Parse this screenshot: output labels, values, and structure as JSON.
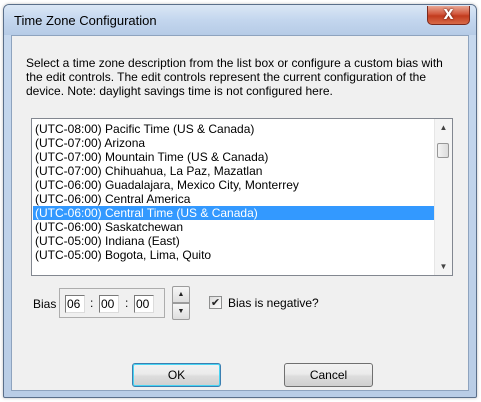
{
  "window": {
    "title": "Time Zone Configuration",
    "close_glyph": "X"
  },
  "description": "Select a time zone description from the list box or configure a custom bias with the edit controls.  The edit controls represent the current configuration of the device.  Note: daylight savings time is not configured here.",
  "timezone_list": {
    "items": [
      "(UTC-08:00) Pacific Time (US & Canada)",
      "(UTC-07:00) Arizona",
      "(UTC-07:00) Mountain Time (US & Canada)",
      "(UTC-07:00) Chihuahua, La Paz, Mazatlan",
      "(UTC-06:00) Guadalajara, Mexico City, Monterrey",
      "(UTC-06:00) Central America",
      "(UTC-06:00) Central Time (US & Canada)",
      "(UTC-06:00) Saskatchewan",
      "(UTC-05:00) Indiana (East)",
      "(UTC-05:00) Bogota, Lima, Quito"
    ],
    "selected_index": 6,
    "scroll_up_icon": "arrow-up-icon",
    "scroll_down_icon": "arrow-down-icon"
  },
  "bias": {
    "label": "Bias",
    "hours": "06",
    "minutes": "00",
    "seconds": "00",
    "separator": ":"
  },
  "negative_checkbox": {
    "label": "Bias is negative?",
    "checked": true
  },
  "buttons": {
    "ok": "OK",
    "cancel": "Cancel"
  },
  "colors": {
    "selection": "#3399ff",
    "dialog_background": "#f0f0f0",
    "close_button": "#c23b1e"
  }
}
